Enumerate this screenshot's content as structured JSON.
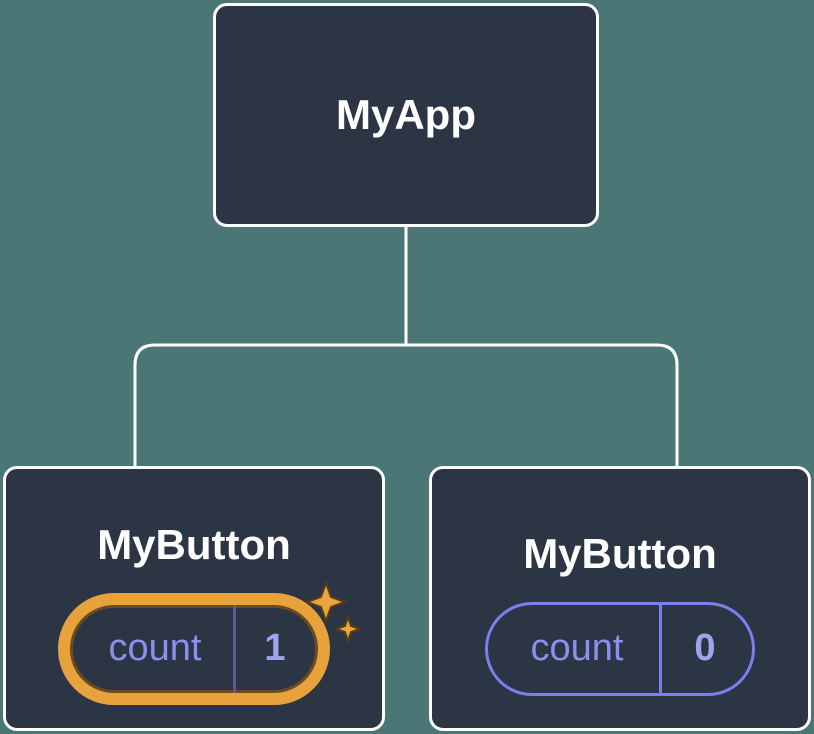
{
  "root": {
    "title": "MyApp"
  },
  "children": [
    {
      "title": "MyButton",
      "state_label": "count",
      "state_value": "1",
      "highlighted": true
    },
    {
      "title": "MyButton",
      "state_label": "count",
      "state_value": "0",
      "highlighted": false
    }
  ],
  "colors": {
    "bg": "#4a7676",
    "node": "#2c3544",
    "border": "#ffffff",
    "pill": "#7a7fef",
    "highlight": "#e8a23c"
  }
}
